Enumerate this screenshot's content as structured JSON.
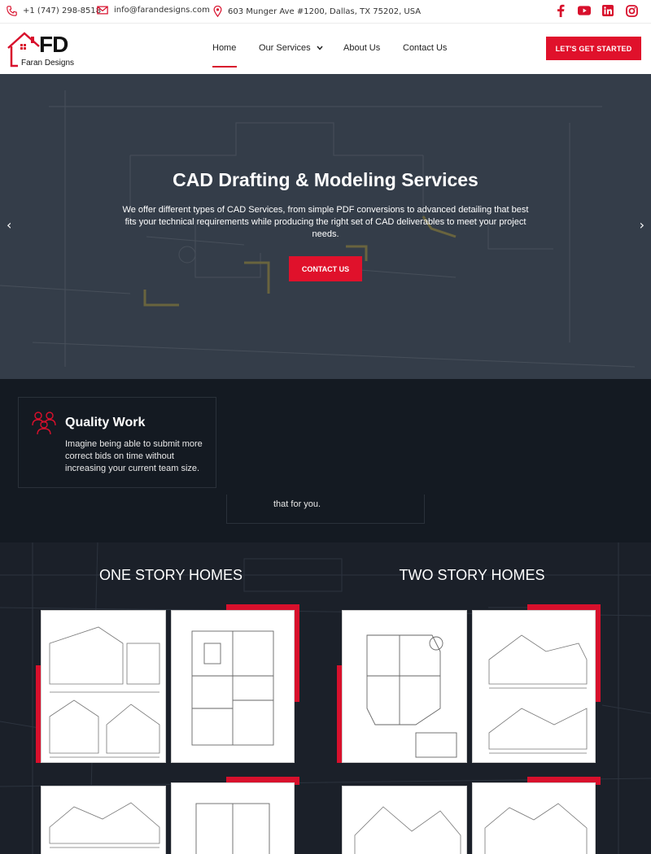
{
  "topbar": {
    "phone": "+1 (747) 298-8518",
    "email": "info@farandesigns.com",
    "address": "603 Munger Ave #1200, Dallas, TX 75202, USA",
    "social": [
      "facebook-icon",
      "youtube-icon",
      "linkedin-icon",
      "instagram-icon"
    ]
  },
  "brand": {
    "logo_text": "FD",
    "name": "Faran Designs",
    "accent": "#e0112b"
  },
  "nav": {
    "items": [
      {
        "label": "Home"
      },
      {
        "label": "Our Services"
      },
      {
        "label": "About Us"
      },
      {
        "label": "Contact Us"
      }
    ],
    "cta": "LET'S GET STARTED"
  },
  "hero": {
    "title": "CAD Drafting & Modeling Services",
    "subtitle": "We offer different types of CAD Services, from simple PDF conversions to advanced detailing that best fits your technical requirements while producing the right set of CAD deliverables to meet your project needs.",
    "button": "CONTACT US"
  },
  "features": {
    "quality_title": "Quality Work",
    "quality_text": "Imagine being able to submit more correct bids on time without increasing your current team size.",
    "second_text": "that for you."
  },
  "portfolio": {
    "one_story": "ONE STORY HOMES",
    "two_story": "TWO STORY HOMES"
  }
}
